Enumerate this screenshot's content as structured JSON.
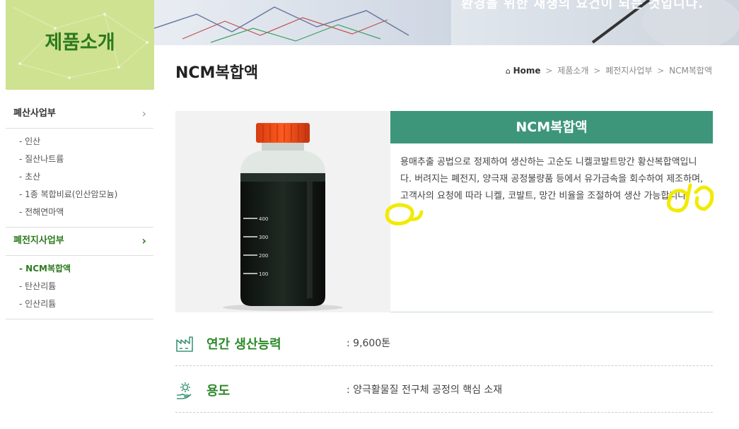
{
  "banner": {
    "text": "환경을 위한 재생의 요건이 되는 것입니다."
  },
  "category": {
    "title": "제품소개"
  },
  "sidebar": {
    "groups": [
      {
        "label": "폐산사업부",
        "chevron": "›",
        "items": [
          "- 인산",
          "- 질산나트륨",
          "- 초산",
          "- 1종 복합비료(인산암모늄)",
          "- 전해연마액"
        ]
      },
      {
        "label": "폐전지사업부",
        "chevron": "›",
        "items": [
          "- NCM복합액",
          "- 탄산리튬",
          "- 인산리튬"
        ]
      }
    ]
  },
  "page": {
    "title": "NCM복합액",
    "breadcrumb": {
      "home": "Home",
      "sep": ">",
      "level1": "제품소개",
      "level2": "폐전지사업부",
      "level3": "NCM복합액"
    }
  },
  "product": {
    "name": "NCM복합액",
    "description": "용매추출 공법으로 정제하여 생산하는 고순도 니켈코발트망간 황산복합액입니다. 버려지는 폐전지, 양극재 공정불량품 등에서 유가금속을 회수하여 제조하며, 고객사의 요청에 따라 니켈, 코발트, 망간 비율을 조절하여 생산 가능합니다.",
    "bottle_marks": [
      "400",
      "300",
      "200",
      "100"
    ]
  },
  "specs": [
    {
      "label": "연간 생산능력",
      "value": ": 9,600톤",
      "icon": "factory-icon"
    },
    {
      "label": "용도",
      "value": ": 양극활물질 전구체 공정의 핵심 소재",
      "icon": "gear-hand-icon"
    }
  ],
  "colors": {
    "accent": "#3d967a",
    "green_text": "#2d8a2a",
    "category_bg": "#cfe291",
    "highlight": "#f2ea00"
  }
}
